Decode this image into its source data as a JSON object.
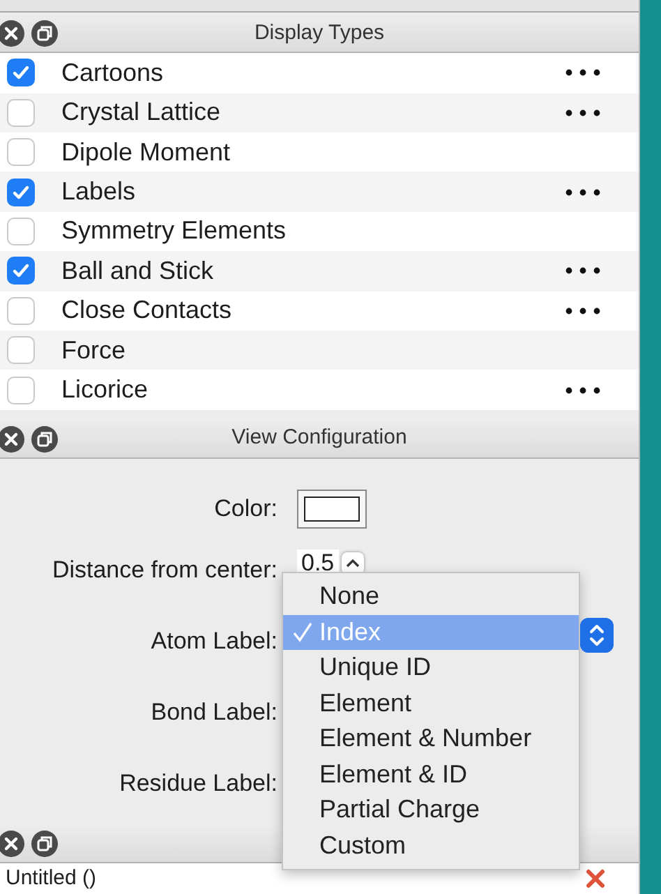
{
  "display_panel": {
    "title": "Display Types",
    "items": [
      {
        "label": "Cartoons",
        "checked": true,
        "has_options": true
      },
      {
        "label": "Crystal Lattice",
        "checked": false,
        "has_options": true
      },
      {
        "label": "Dipole Moment",
        "checked": false,
        "has_options": false
      },
      {
        "label": "Labels",
        "checked": true,
        "has_options": true
      },
      {
        "label": "Symmetry Elements",
        "checked": false,
        "has_options": false
      },
      {
        "label": "Ball and Stick",
        "checked": true,
        "has_options": true
      },
      {
        "label": "Close Contacts",
        "checked": false,
        "has_options": true
      },
      {
        "label": "Force",
        "checked": false,
        "has_options": false
      },
      {
        "label": "Licorice",
        "checked": false,
        "has_options": true
      }
    ]
  },
  "view_panel": {
    "title": "View Configuration",
    "fields": [
      {
        "kind": "color",
        "label": "Color:"
      },
      {
        "kind": "spin",
        "label": "Distance from center:",
        "value": "0.5"
      },
      {
        "kind": "combo",
        "label": "Atom Label:"
      },
      {
        "kind": "combo",
        "label": "Bond Label:"
      },
      {
        "kind": "combo",
        "label": "Residue Label:"
      }
    ],
    "atom_label_menu": [
      {
        "label": "None",
        "selected": false
      },
      {
        "label": "Index",
        "selected": true
      },
      {
        "label": "Unique ID",
        "selected": false
      },
      {
        "label": "Element",
        "selected": false
      },
      {
        "label": "Element & Number",
        "selected": false
      },
      {
        "label": "Element & ID",
        "selected": false
      },
      {
        "label": "Partial Charge",
        "selected": false
      },
      {
        "label": "Custom",
        "selected": false
      }
    ]
  },
  "document_panel": {
    "title": "Untitled ()"
  }
}
